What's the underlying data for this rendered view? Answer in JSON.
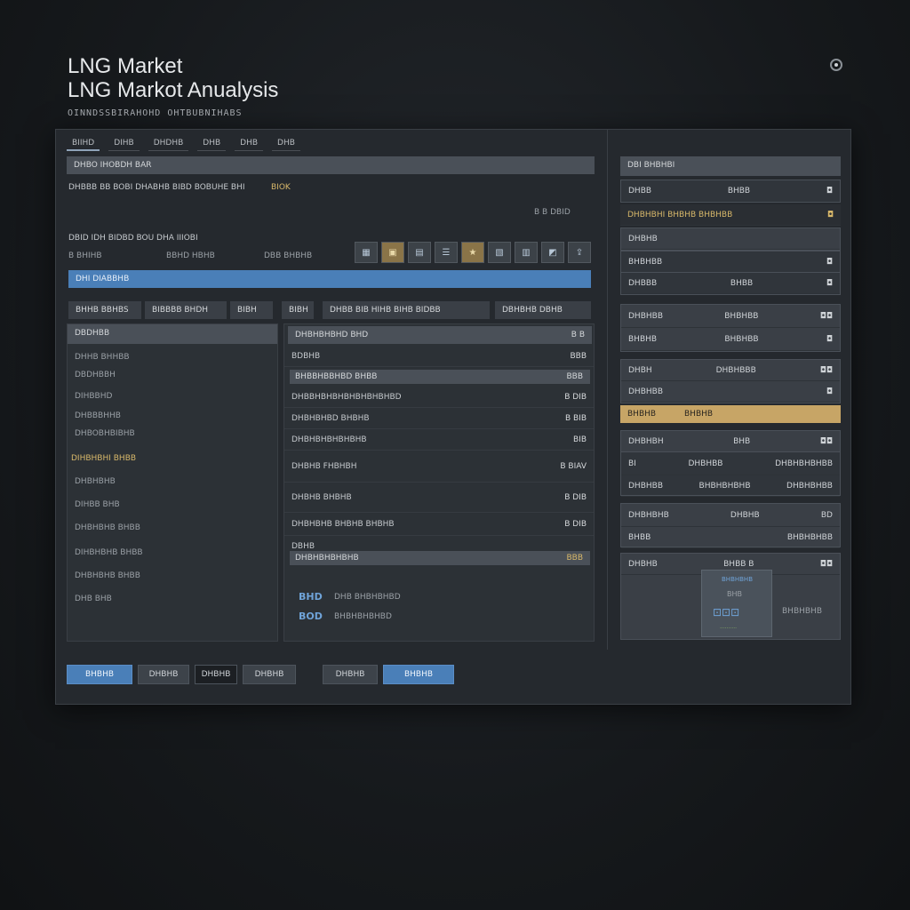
{
  "header": {
    "title_line1": "LNG Market",
    "title_line2": "LNG Markot Anualysis",
    "subtitle": "OINNDSSBIRAHOHD OHTBUBNIHABS"
  },
  "tabs": [
    "BIIHD",
    "DIHB",
    "DHDHB",
    "DHB",
    "DHB",
    "DHB"
  ],
  "left": {
    "section_bar": "DHBO IHOBDH BAR",
    "info_line": "DHBBB   BB  BOBI  DHABHB  BIBD  BOBUHE  BHI",
    "info_highlight": "BIOK",
    "right_small": "B B DBID",
    "sub_heading": "DBID IDH BIDBD BOU DHA IIIOBI",
    "sub_a": "B BHIHB",
    "sub_b": "BBHD HBHB",
    "sub_c": "DBB BHBHB",
    "progress_label": "DHI DIABBHB",
    "filter_1": "BHHB BBHBS",
    "filter_2": "BIBBBB BHDH",
    "filter_3": "BIBH",
    "filter_4": "BIBH",
    "filter_5": "DHBB BIB HIHB BIHB BIDBB",
    "filter_6": "DBHBHB DBHB",
    "list_header": "DBDHBB",
    "list_items": [
      "DHHB BHHBB",
      "DBDHBBH",
      "DIHBBHD",
      "DHBBBHHB",
      "DHBOBHBIBHB",
      "DIHBHBHI BHBB",
      "DHBHBHB",
      "DIHBB BHB",
      "DHBHBHB BHBB",
      "DIHBHBHB BHBB",
      "DHBHBHB BHBB",
      "DHB BHB"
    ],
    "table_header": "DHBHBHBHD BHD",
    "table_header_right": "B B",
    "table_sub": "BDBHB",
    "table_sub_right": "BBB",
    "table_group": "BHBBHBBHBD BHBB",
    "table_group_right": "BBB",
    "table_rows": [
      {
        "label": "DHBBHBHBHBHBHBHBHBD",
        "value": "B DIB"
      },
      {
        "label": "DHBHBHBD BHBHB",
        "value": "B BIB"
      },
      {
        "label": "DHBHBHBHBHBHB",
        "value": "BIB"
      },
      {
        "label": "DHBHB  FHBHBH",
        "value": "B BIAV"
      },
      {
        "label": "DHBHB  BHBHB",
        "value": "B DIB"
      },
      {
        "label": "DHBHBHB BHBHB  BHBHB",
        "value": "B DIB"
      },
      {
        "label": "DBHB",
        "value": ""
      }
    ],
    "table_footer": "DHBHBHBHBHB",
    "table_footer_right": "BBB",
    "legend_1_code": "BHD",
    "legend_1_text": "DHB BHBHBHBD",
    "legend_2_code": "BOD",
    "legend_2_text": "BHBHBHBHBD"
  },
  "right": {
    "header": "DBI BHBHBI",
    "r1_label": "DHBB",
    "r1_val": "BHBB",
    "r2_label": "DHBHBHI BHBHB BHBHBB",
    "r3_label": "DHBHB",
    "r4_label": "BHBHBB",
    "r5_label": "DHBBB",
    "r5_val": "BHBB",
    "g1_a": "DHBHBB",
    "g1_b": "BHBHBB",
    "g1_c": "BHBHB",
    "g1_d": "BHBHBB",
    "g2_a": "DHBH",
    "g2_b": "DHBHBBB",
    "g2_c": "DHBHBB",
    "highlight_a": "BHBHB",
    "highlight_b": "BHBHB",
    "g3_a": "DHBHBH",
    "g3_b": "BHB",
    "g4_a": "BI",
    "g4_b": "DHBHBB",
    "g4_c": "DHBHBHBHBB",
    "g5_a": "DHBHBB",
    "g5_b": "BHBHBHBHB",
    "g5_c": "DHBHBHBB",
    "g6_a": "DHBHBHB",
    "g6_b": "DHBHB",
    "g6_c": "BD",
    "g7_a": "BHBB",
    "g7_b": "BHBHBHBB",
    "g8_a": "DHBHB",
    "g8_b": "BHBB B",
    "thumb_label": "BHBHBHB",
    "thumb_sub": "BHB",
    "thumb_side": "BHBHBHB"
  },
  "buttons": [
    "BHBHB",
    "DHBHB",
    "DHBHB",
    "DHBHB",
    "DHBHB",
    "BHBHB"
  ]
}
